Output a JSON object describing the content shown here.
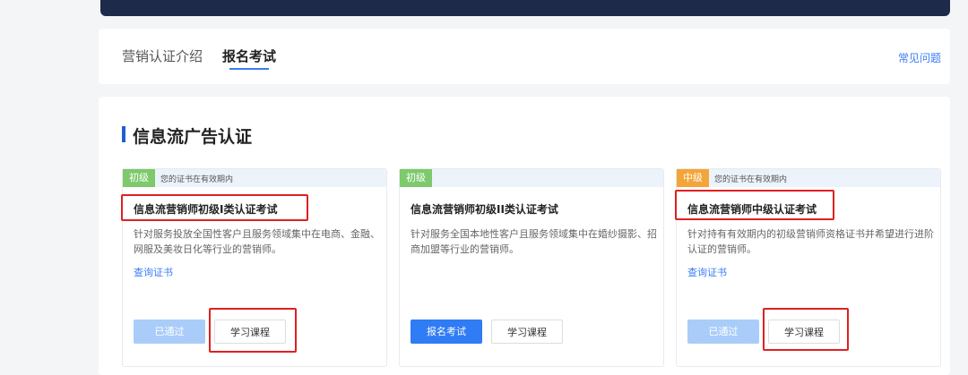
{
  "tabs": [
    {
      "label": "营销认证介绍"
    },
    {
      "label": "报名考试"
    }
  ],
  "faq_label": "常见问题",
  "section_title": "信息流广告认证",
  "cards": [
    {
      "level": "初级",
      "status": "您的证书在有效期内",
      "title": "信息流营销师初级I类认证考试",
      "desc": "针对服务投放全国性客户且服务领域集中在电商、金融、网服及美妆日化等行业的营销师。",
      "query_label": "查询证书",
      "primary_label": "已通过",
      "course_label": "学习课程"
    },
    {
      "level": "初级",
      "status": "",
      "title": "信息流营销师初级II类认证考试",
      "desc": "针对服务全国本地性客户且服务领域集中在婚纱摄影、招商加盟等行业的营销师。",
      "primary_label": "报名考试",
      "course_label": "学习课程"
    },
    {
      "level": "中级",
      "status": "您的证书在有效期内",
      "title": "信息流营销师中级认证考试",
      "desc": "针对持有有效期内的初级营销师资格证书并希望进行进阶认证的营销师。",
      "query_label": "查询证书",
      "primary_label": "已通过",
      "course_label": "学习课程"
    }
  ],
  "colors": {
    "accent": "#3b7cf4",
    "highlight": "#e02020",
    "badge_junior": "#7dc96b",
    "badge_mid": "#f3a53a"
  }
}
